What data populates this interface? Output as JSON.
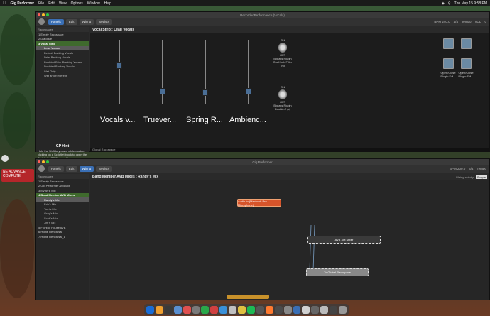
{
  "menubar": {
    "app": "Gig Performer",
    "items": [
      "File",
      "Edit",
      "View",
      "Options",
      "Window",
      "Help"
    ],
    "clock": "Thu May 15  9:58 PM"
  },
  "top_window": {
    "title": "RecordedPerformance (Vocals)",
    "toolbar": {
      "panels": "Panels",
      "edit": "Edit",
      "wiring": "Wiring",
      "setlists": "Setlists",
      "bpm": "BPM 240.0",
      "time_sig": "4/4",
      "tempo_label": "Tempo",
      "vol": "VOL",
      "zero": "0"
    },
    "sidebar_header": "Rackspaces",
    "sidebar": [
      {
        "label": "1  Empty Rackspace",
        "state": "normal"
      },
      {
        "label": "2  Dialogue",
        "state": "normal"
      },
      {
        "label": "3  Vocal Strip",
        "state": "selected"
      },
      {
        "label": "Lead Vocals",
        "state": "childsel"
      },
      {
        "label": "Default Backing Vocals",
        "state": "child"
      },
      {
        "label": "Drier Backing Vocals",
        "state": "child"
      },
      {
        "label": "Doubled Drier Backing Vocals",
        "state": "child"
      },
      {
        "label": "Doubled Backing Vocals",
        "state": "child"
      },
      {
        "label": "Wet Only",
        "state": "child"
      },
      {
        "label": "Wet and Reverent",
        "state": "child"
      }
    ],
    "hint_title": "GP Hint",
    "hint_text": "Hold the Shift key down while double-clicking on a Scriptlet block to open the Scriptlet's GP Script editor.",
    "hint_link": "Show hint",
    "hint_more": "No more hints",
    "panel_title": "Vocal Strip : Lead Vocals",
    "faders": [
      "Vocals v...",
      "Truever...",
      "Spring R...",
      "Ambienc..."
    ],
    "fader_levels": [
      0.62,
      0.2,
      0.18,
      0.2
    ],
    "switches": [
      {
        "on": "ON",
        "off": "OFF",
        "name": "Bypass Plugin OneKnob Filter (m)"
      },
      {
        "on": "ON",
        "off": "OFF",
        "name": "Bypass Plugin Doubler2 (s)"
      }
    ],
    "open_close": [
      {
        "label": "Open/Close Plugin Edi..."
      },
      {
        "label": "Open/Close Plugin Edi..."
      }
    ],
    "status": "Global Rackspace"
  },
  "bottom_window": {
    "title": "Gig Performer",
    "toolbar": {
      "panels": "Panels",
      "edit": "Edit",
      "wiring": "Wiring",
      "setlists": "Setlists",
      "bpm": "BPM 200.0",
      "time_sig": "4/4",
      "tempo_label": "Tempo"
    },
    "sidebar_header": "Rackspaces",
    "sidebar": [
      {
        "label": "1  Empty Rackspace",
        "state": "normal"
      },
      {
        "label": "2  Gig Performer AVB Mix",
        "state": "normal"
      },
      {
        "label": "3  My AVB Mix",
        "state": "normal"
      },
      {
        "label": "4  Band Member AVB Mixes",
        "state": "selected"
      },
      {
        "label": "Randy's Mix",
        "state": "childsel"
      },
      {
        "label": "Erin's Mix",
        "state": "child"
      },
      {
        "label": "Tom's Mix",
        "state": "child"
      },
      {
        "label": "Greg's Mix",
        "state": "child"
      },
      {
        "label": "Scott's Mix",
        "state": "child"
      },
      {
        "label": "Jim's Mix",
        "state": "child"
      },
      {
        "label": "5  Front of House AVB",
        "state": "normal"
      },
      {
        "label": "6  Home Rehearsal",
        "state": "normal"
      },
      {
        "label": "7  Home Rehearsal_1",
        "state": "normal"
      }
    ],
    "panel_title": "Band Member AVB Mixes : Randy's Mix",
    "wiring_label": "Wiring activity",
    "wiring_mode": "Simple",
    "nodes": {
      "audio_in": "Audio In (Macbook Pro Microphone)",
      "avb": "AVB XM Mixer",
      "to_global": "To Global Rackspace"
    },
    "status": "Rackspaces"
  },
  "desktop_stickers": [
    "NE ADVANCE COMPUTE"
  ]
}
